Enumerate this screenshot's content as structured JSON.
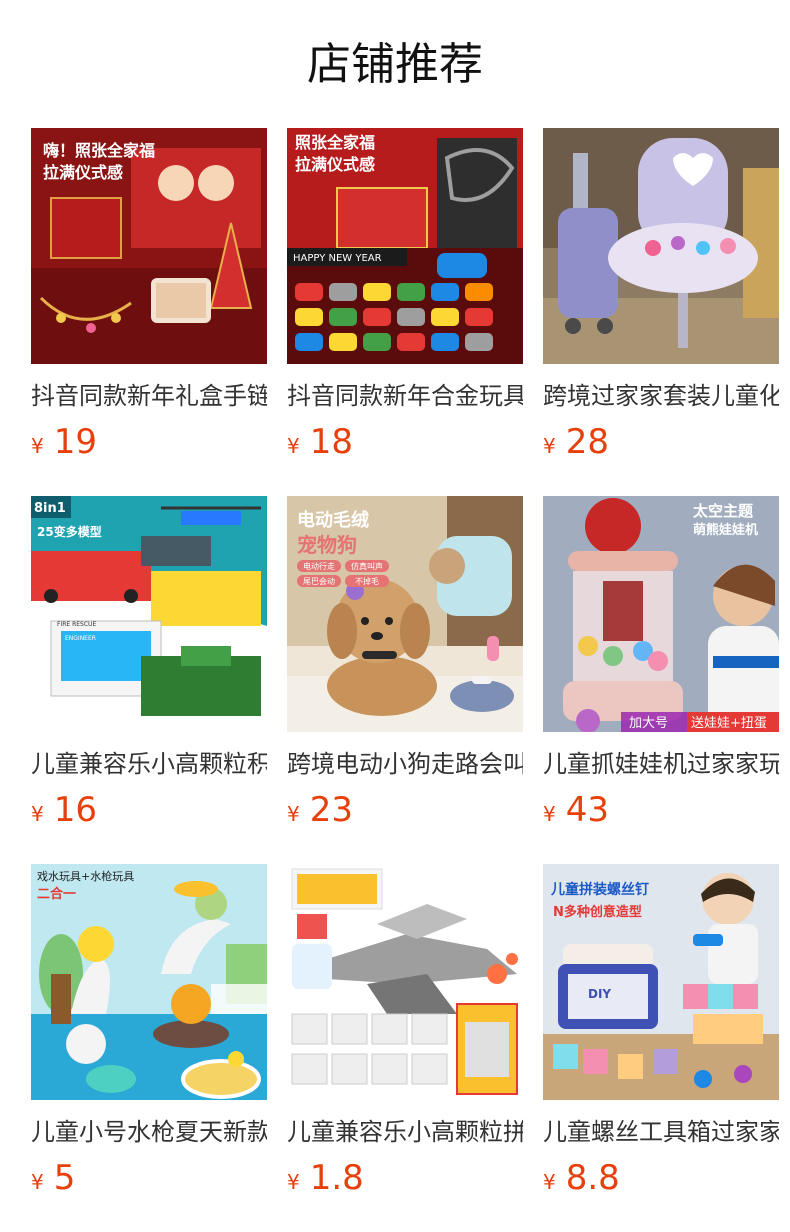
{
  "header": {
    "title": "店铺推荐"
  },
  "currency_symbol": "¥",
  "products": [
    {
      "name": "抖音同款新年礼盒手链",
      "price": "19",
      "image_text": [
        "嗨！照张全家福",
        "拉满仪式感"
      ]
    },
    {
      "name": "抖音同款新年合金玩具车",
      "price": "18",
      "image_text": [
        "照张全家福",
        "拉满仪式感",
        "HAPPY NEW YEAR"
      ]
    },
    {
      "name": "跨境过家家套装儿童化妆",
      "price": "28",
      "image_text": []
    },
    {
      "name": "儿童兼容乐小高颗粒积木",
      "price": "16",
      "image_text": [
        "8in1",
        "25变多模型",
        "FIRE RESCUE",
        "ENGINEER"
      ]
    },
    {
      "name": "跨境电动小狗走路会叫",
      "price": "23",
      "image_text": [
        "电动毛绒",
        "宠物狗",
        "电动行走",
        "仿真叫声",
        "尾巴会动",
        "不掉毛"
      ]
    },
    {
      "name": "儿童抓娃娃机过家家玩具",
      "price": "43",
      "image_text": [
        "太空主题",
        "萌熊娃娃机",
        "加大号",
        "送娃娃+扭蛋"
      ]
    },
    {
      "name": "儿童小号水枪夏天新款",
      "price": "5",
      "image_text": [
        "戏水玩具+水枪玩具",
        "二合一"
      ]
    },
    {
      "name": "儿童兼容乐小高颗粒拼装",
      "price": "1.8",
      "image_text": []
    },
    {
      "name": "儿童螺丝工具箱过家家",
      "price": "8.8",
      "image_text": [
        "儿童拼装螺丝钉",
        "N多种创意造型",
        "DIY"
      ]
    }
  ]
}
